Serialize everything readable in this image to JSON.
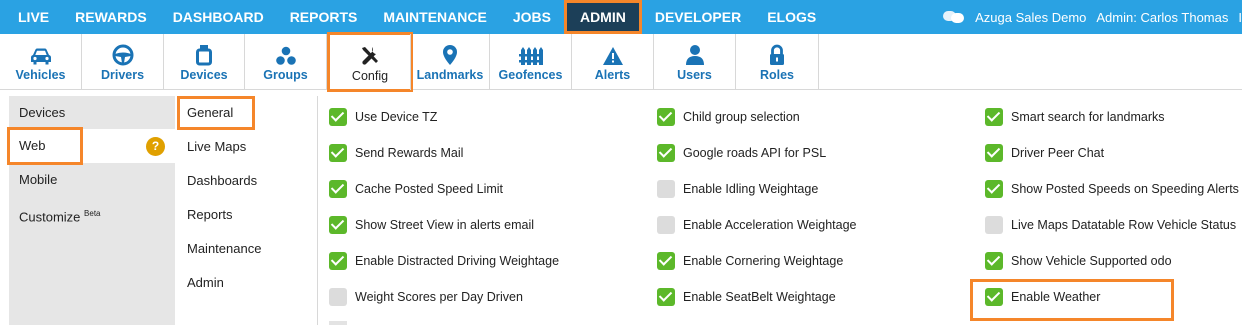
{
  "topnav": {
    "items": [
      "LIVE",
      "REWARDS",
      "DASHBOARD",
      "REPORTS",
      "MAINTENANCE",
      "JOBS",
      "ADMIN",
      "DEVELOPER",
      "ELOGS"
    ],
    "active": "ADMIN",
    "account": "Azuga Sales Demo",
    "user": "Admin: Carlos Thomas",
    "truncated": "I"
  },
  "iconbar": {
    "items": [
      {
        "label": "Vehicles",
        "icon": "car-icon"
      },
      {
        "label": "Drivers",
        "icon": "steering-wheel-icon"
      },
      {
        "label": "Devices",
        "icon": "device-icon"
      },
      {
        "label": "Groups",
        "icon": "groups-icon"
      },
      {
        "label": "Config",
        "icon": "tools-icon"
      },
      {
        "label": "Landmarks",
        "icon": "map-pin-icon"
      },
      {
        "label": "Geofences",
        "icon": "fence-icon"
      },
      {
        "label": "Alerts",
        "icon": "warning-icon"
      },
      {
        "label": "Users",
        "icon": "user-icon"
      },
      {
        "label": "Roles",
        "icon": "lock-icon"
      }
    ],
    "selected": "Config",
    "icon_color": "#1a73b5"
  },
  "sidebar": {
    "items": [
      {
        "label": "Devices"
      },
      {
        "label": "Web",
        "help": "?"
      },
      {
        "label": "Mobile"
      },
      {
        "label": "Customize",
        "sup": "Beta"
      }
    ],
    "selected": "Web"
  },
  "subnav": {
    "items": [
      "General",
      "Live Maps",
      "Dashboards",
      "Reports",
      "Maintenance",
      "Admin"
    ],
    "selected": "General"
  },
  "settings": {
    "col1": [
      {
        "label": "Use Device TZ",
        "checked": true
      },
      {
        "label": "Send Rewards Mail",
        "checked": true
      },
      {
        "label": "Cache Posted Speed Limit",
        "checked": true
      },
      {
        "label": "Show Street View in alerts email",
        "checked": true
      },
      {
        "label": "Enable Distracted Driving Weightage",
        "checked": true
      },
      {
        "label": "Weight Scores per Day Driven",
        "checked": false
      }
    ],
    "col2": [
      {
        "label": "Child group selection",
        "checked": true
      },
      {
        "label": "Google roads API for PSL",
        "checked": true
      },
      {
        "label": "Enable Idling Weightage",
        "checked": false
      },
      {
        "label": "Enable Acceleration Weightage",
        "checked": false
      },
      {
        "label": "Enable Cornering Weightage",
        "checked": true
      },
      {
        "label": "Enable SeatBelt Weightage",
        "checked": true
      }
    ],
    "col3": [
      {
        "label": "Smart search for landmarks",
        "checked": true
      },
      {
        "label": "Driver Peer Chat",
        "checked": true
      },
      {
        "label": "Show Posted Speeds on Speeding Alerts",
        "checked": true
      },
      {
        "label": "Live Maps Datatable Row Vehicle Status",
        "checked": false
      },
      {
        "label": "Show Vehicle Supported odo",
        "checked": true
      },
      {
        "label": "Enable Weather",
        "checked": true
      }
    ]
  },
  "colors": {
    "nav": "#2aa2e3",
    "active": "#1c3f58",
    "highlight": "#f5862a",
    "check": "#5cb82a"
  }
}
